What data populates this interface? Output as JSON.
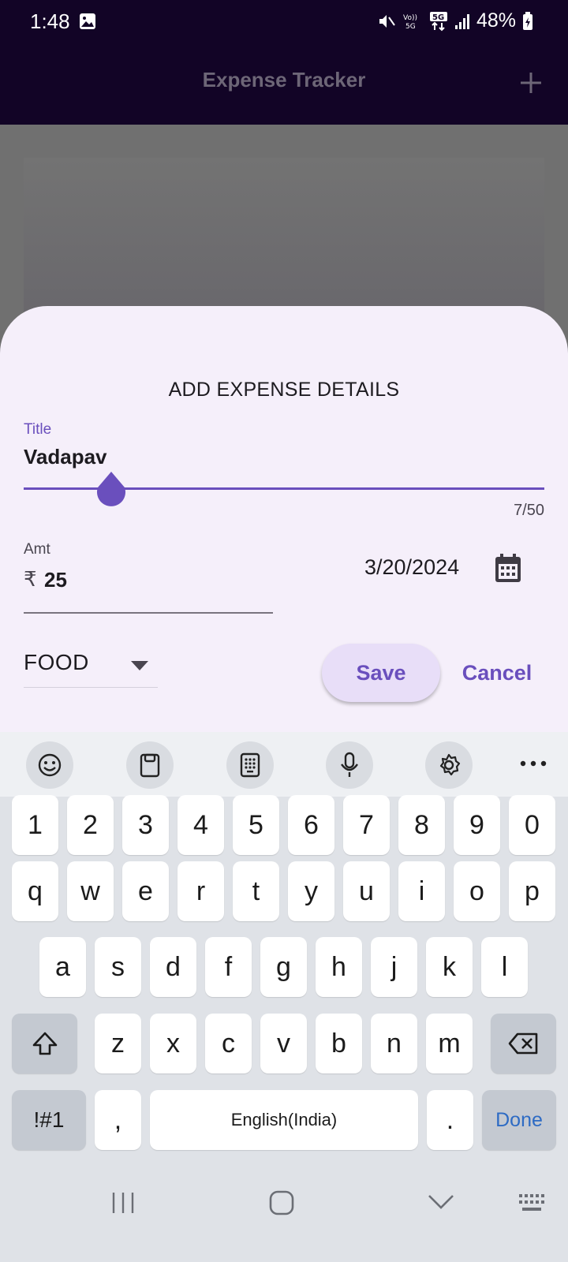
{
  "status_bar": {
    "time": "1:48",
    "battery_percent": "48%",
    "network_labels": [
      "Vo)) 5G",
      "5G"
    ],
    "icons": [
      "gallery-icon",
      "mute-icon",
      "volte-icon",
      "5g-data-icon",
      "signal-icon",
      "battery-icon"
    ]
  },
  "app_bar": {
    "title": "Expense Tracker",
    "action_icon": "add-icon"
  },
  "sheet": {
    "heading": "ADD EXPENSE DETAILS",
    "title_field": {
      "label": "Title",
      "value": "Vadapav",
      "counter": "7/50"
    },
    "amount_field": {
      "label": "Amt",
      "currency_symbol": "₹",
      "value": "25"
    },
    "date": "3/20/2024",
    "category": "FOOD",
    "save_label": "Save",
    "cancel_label": "Cancel"
  },
  "colors": {
    "accent": "#6a4fbd",
    "sheet_background": "#f5effa",
    "app_bar": "#120426",
    "save_button_bg": "#e8def8"
  },
  "keyboard": {
    "toolbar_icons": [
      "emoji-icon",
      "clipboard-icon",
      "keypad-icon",
      "mic-icon",
      "settings-icon",
      "more-icon"
    ],
    "row_numbers": [
      "1",
      "2",
      "3",
      "4",
      "5",
      "6",
      "7",
      "8",
      "9",
      "0"
    ],
    "row1": [
      "q",
      "w",
      "e",
      "r",
      "t",
      "y",
      "u",
      "i",
      "o",
      "p"
    ],
    "row2": [
      "a",
      "s",
      "d",
      "f",
      "g",
      "h",
      "j",
      "k",
      "l"
    ],
    "row3": [
      "z",
      "x",
      "c",
      "v",
      "b",
      "n",
      "m"
    ],
    "symbols_label": "!#1",
    "comma_label": ",",
    "space_label": "English(India)",
    "period_label": ".",
    "done_label": "Done"
  },
  "nav_bar": {
    "icons": [
      "recents-icon",
      "home-icon",
      "back-icon",
      "keyboard-switch-icon"
    ]
  }
}
